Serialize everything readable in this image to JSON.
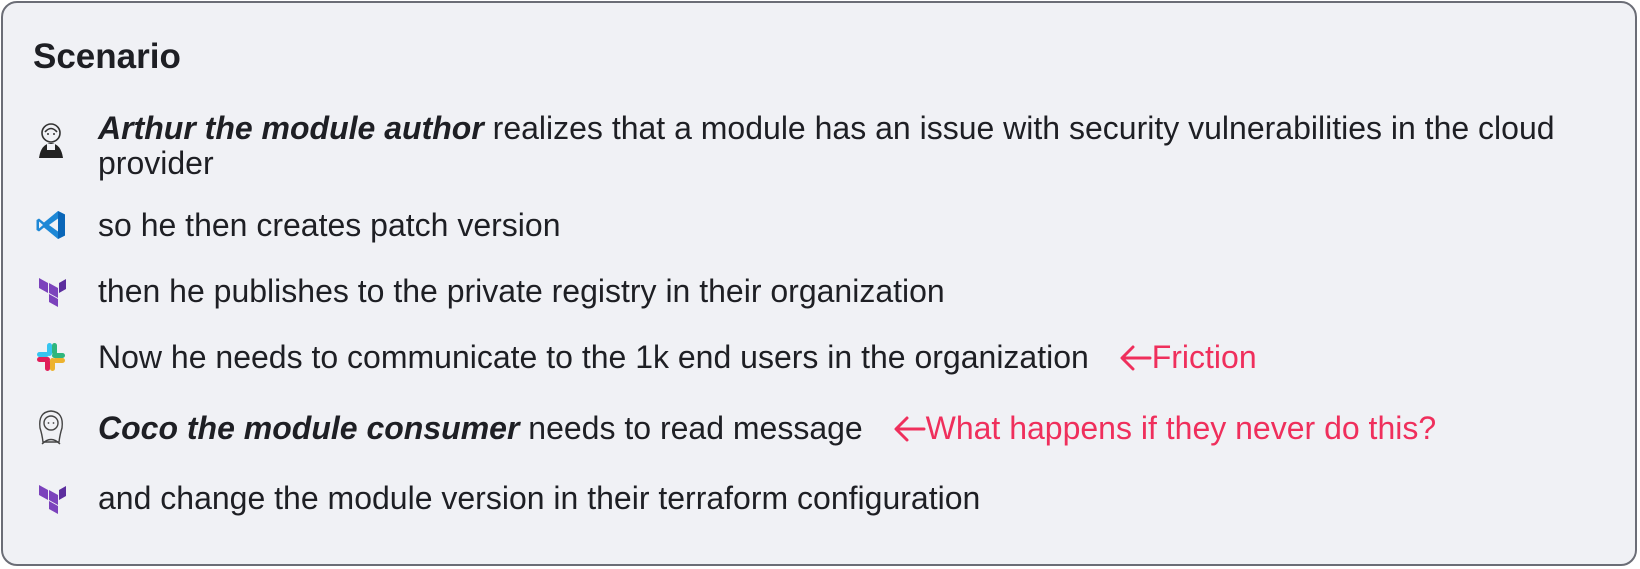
{
  "title": "Scenario",
  "rows": [
    {
      "icon": "arthur-avatar-icon",
      "bold": "Arthur the module author",
      "text": " realizes that a module has an issue with security vulnerabilities in the cloud provider"
    },
    {
      "icon": "vscode-icon",
      "text": "so he then creates patch version"
    },
    {
      "icon": "terraform-icon",
      "text": "then he publishes to the private registry in their organization"
    },
    {
      "icon": "slack-icon",
      "text": "Now he needs to communicate to the 1k end users in the organization",
      "note": "Friction"
    },
    {
      "icon": "coco-avatar-icon",
      "bold": "Coco the module consumer",
      "text": " needs to read  message",
      "note": "What happens if they never do this?"
    },
    {
      "icon": "terraform-icon",
      "text": "and change the module version in their terraform configuration"
    }
  ],
  "colors": {
    "accent": "#ef2f5c",
    "background": "#f0f1f5",
    "border": "#6b6d76",
    "text": "#1e1f24",
    "terraform": "#7b42bc",
    "vscode": "#0a7acc"
  }
}
